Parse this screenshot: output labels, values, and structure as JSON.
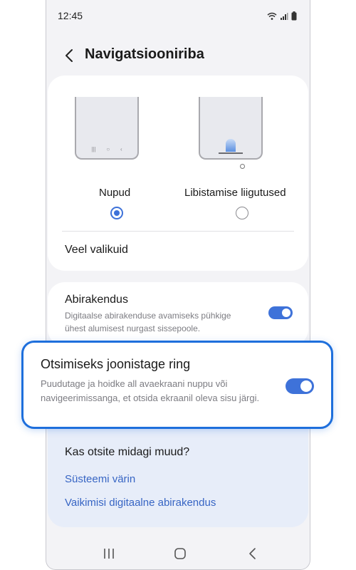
{
  "status_bar": {
    "time": "12:45"
  },
  "header": {
    "title": "Navigatsiooniriba"
  },
  "navigation_type": {
    "options": [
      {
        "label": "Nupud",
        "selected": true
      },
      {
        "label": "Libistamise liigutused",
        "selected": false
      }
    ],
    "more_options": "Veel valikuid"
  },
  "assistant": {
    "title": "Abirakendus",
    "description": "Digitaalse abirakenduse avamiseks pühkige ühest alumisest nurgast sissepoole.",
    "enabled": true
  },
  "circle_to_search": {
    "title": "Otsimiseks joonistage ring",
    "description": "Puudutage ja hoidke all avaekraani nuppu või navigeerimissanga, et otsida ekraanil oleva sisu järgi.",
    "enabled": true
  },
  "looking_for_more": {
    "title": "Kas otsite midagi muud?",
    "links": [
      "Süsteemi värin",
      "Vaikimisi digitaalne abirakendus"
    ]
  },
  "colors": {
    "accent": "#3e72d9",
    "highlight_border": "#1e6fdc",
    "link": "#3765c4"
  },
  "icons": {
    "back": "chevron-left-icon",
    "recents": "recents-icon",
    "home": "home-icon",
    "nav_back": "back-nav-icon"
  }
}
